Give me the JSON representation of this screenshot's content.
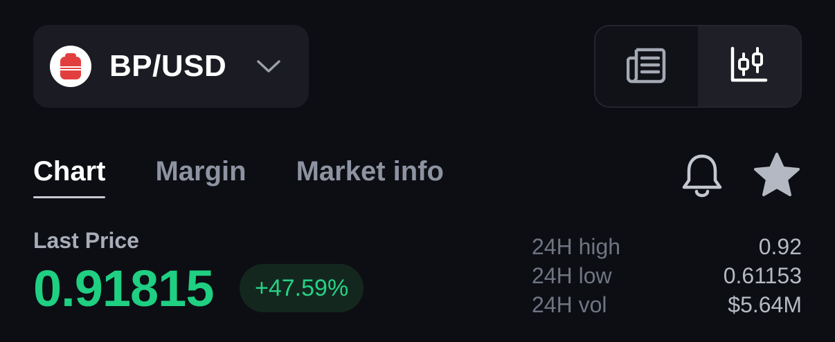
{
  "pair": {
    "name": "BP/USD",
    "logo_icon": "backpack-icon",
    "logo_color": "#e33e3f"
  },
  "view_toggle": {
    "options": [
      {
        "icon": "news-icon",
        "active": false
      },
      {
        "icon": "candlestick-chart-icon",
        "active": true
      }
    ]
  },
  "tabs": [
    {
      "label": "Chart",
      "active": true
    },
    {
      "label": "Margin",
      "active": false
    },
    {
      "label": "Market info",
      "active": false
    }
  ],
  "actions": {
    "alert_icon": "bell-icon",
    "favorite_icon": "star-icon"
  },
  "price": {
    "label": "Last Price",
    "value": "0.91815",
    "change": "+47.59%",
    "positive_color": "#1fcf82"
  },
  "stats": [
    {
      "label": "24H high",
      "value": "0.92"
    },
    {
      "label": "24H low",
      "value": "0.61153"
    },
    {
      "label": "24H vol",
      "value": "$5.64M"
    }
  ]
}
